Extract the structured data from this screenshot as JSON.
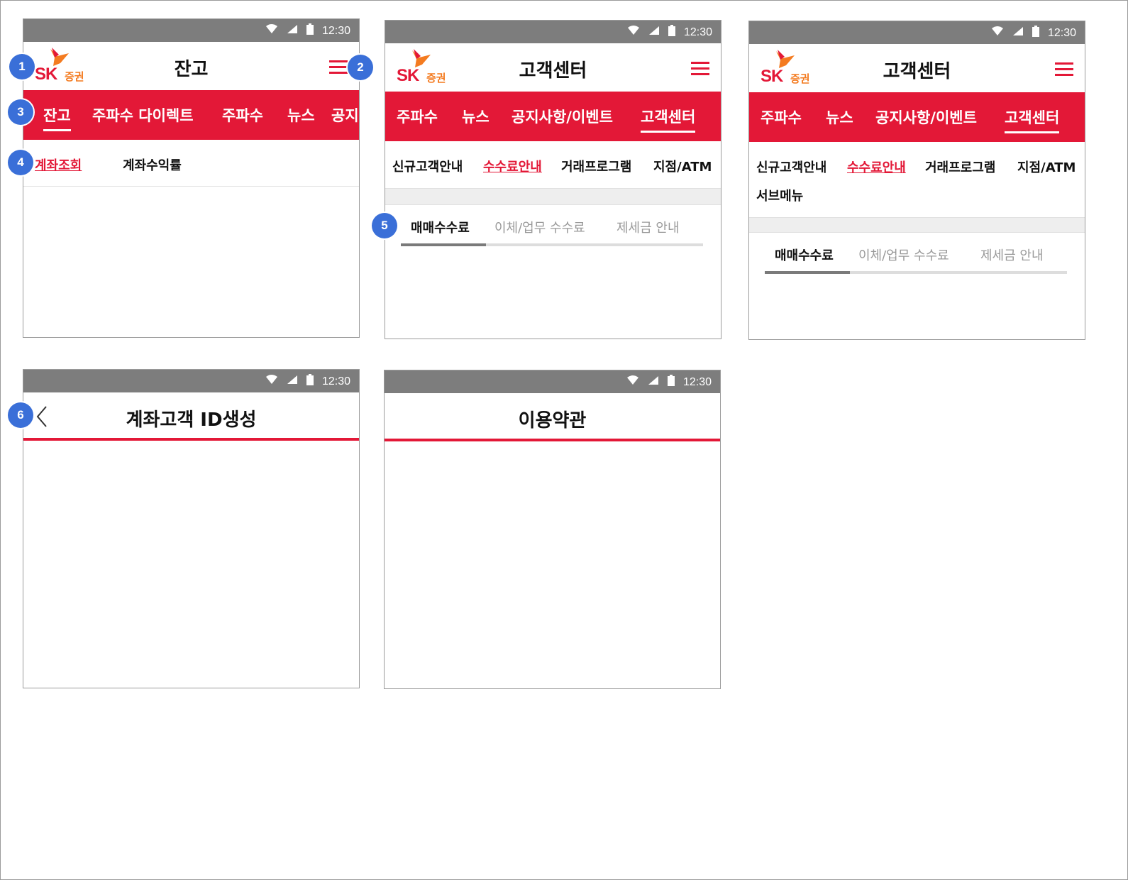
{
  "status": {
    "time": "12:30",
    "icons": [
      "wifi-icon",
      "signal-icon",
      "battery-icon"
    ]
  },
  "colors": {
    "brand_red": "#e31837",
    "logo_orange": "#f47b20",
    "badge_blue": "#3a6fd8",
    "status_gray": "#7d7d7d"
  },
  "logo": {
    "sk": "SK",
    "jeunggwon": "증권"
  },
  "badges": [
    "1",
    "2",
    "3",
    "4",
    "5",
    "6"
  ],
  "screen1": {
    "title": "잔고",
    "nav": [
      "잔고",
      "주파수 다이렉트",
      "주파수",
      "뉴스",
      "공지"
    ],
    "sub": [
      "계좌조회",
      "계좌수익률"
    ]
  },
  "screen2": {
    "title": "고객센터",
    "nav": [
      "주파수",
      "뉴스",
      "공지사항/이벤트",
      "고객센터"
    ],
    "sub": [
      "신규고객안내",
      "수수료안내",
      "거래프로그램",
      "지점/ATM"
    ],
    "tabs": [
      "매매수수료",
      "이체/업무 수수료",
      "제세금 안내"
    ]
  },
  "screen3": {
    "title": "고객센터",
    "nav": [
      "주파수",
      "뉴스",
      "공지사항/이벤트",
      "고객센터"
    ],
    "sub": [
      "신규고객안내",
      "수수료안내",
      "거래프로그램",
      "지점/ATM",
      "서브메뉴"
    ],
    "tabs": [
      "매매수수료",
      "이체/업무 수수료",
      "제세금 안내"
    ]
  },
  "screen4": {
    "title": "계좌고객 ID생성"
  },
  "screen5": {
    "title": "이용약관"
  }
}
